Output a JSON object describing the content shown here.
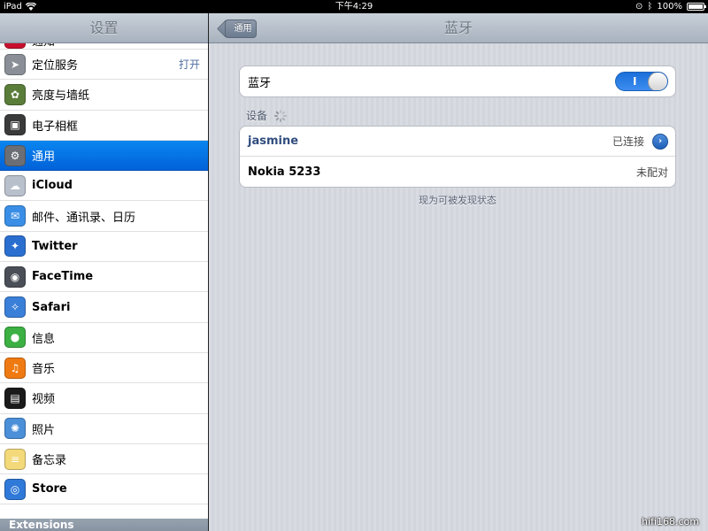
{
  "status_bar": {
    "device": "iPad",
    "time": "下午4:29",
    "battery": "100%"
  },
  "sidebar": {
    "title": "设置",
    "items": [
      {
        "label": "通知",
        "icon": "notifications-icon",
        "color": "#c8102e"
      },
      {
        "label": "定位服务",
        "icon": "location-arrow-icon",
        "color": "#8a8f97",
        "value": "打开"
      },
      {
        "label": "亮度与墙纸",
        "icon": "flower-wallpaper-icon",
        "color": "#5a7d3a"
      },
      {
        "label": "电子相框",
        "icon": "picture-frame-icon",
        "color": "#3a3a3a"
      },
      {
        "label": "通用",
        "icon": "gear-icon",
        "color": "#6b6f75",
        "selected": true
      },
      {
        "label": "iCloud",
        "icon": "cloud-icon",
        "color": "#b8c0cc"
      },
      {
        "label": "邮件、通讯录、日历",
        "icon": "mail-envelope-icon",
        "color": "#3a8ee6"
      },
      {
        "label": "Twitter",
        "icon": "twitter-bird-icon",
        "color": "#2a6fd0"
      },
      {
        "label": "FaceTime",
        "icon": "facetime-camera-icon",
        "color": "#4a4f57"
      },
      {
        "label": "Safari",
        "icon": "safari-compass-icon",
        "color": "#3a7fd8"
      },
      {
        "label": "信息",
        "icon": "messages-bubble-icon",
        "color": "#3cb043"
      },
      {
        "label": "音乐",
        "icon": "music-note-icon",
        "color": "#f07a12"
      },
      {
        "label": "视频",
        "icon": "film-strip-icon",
        "color": "#1a1a1a"
      },
      {
        "label": "照片",
        "icon": "sunflower-icon",
        "color": "#4a8fd8"
      },
      {
        "label": "备忘录",
        "icon": "notes-pad-icon",
        "color": "#f3d97a"
      },
      {
        "label": "Store",
        "icon": "app-store-icon",
        "color": "#2f79d8"
      }
    ],
    "footer": "Extensions"
  },
  "detail": {
    "title": "蓝牙",
    "back_label": "通用",
    "bluetooth_row": {
      "label": "蓝牙",
      "toggle_on_text": "I"
    },
    "devices_header": "设备",
    "devices": [
      {
        "name": "jasmine",
        "status": "已连接",
        "has_detail": true
      },
      {
        "name": "Nokia 5233",
        "status": "未配对",
        "has_detail": false
      }
    ],
    "discoverable_text": "现为可被发现状态"
  },
  "watermark": "hifi168.com"
}
